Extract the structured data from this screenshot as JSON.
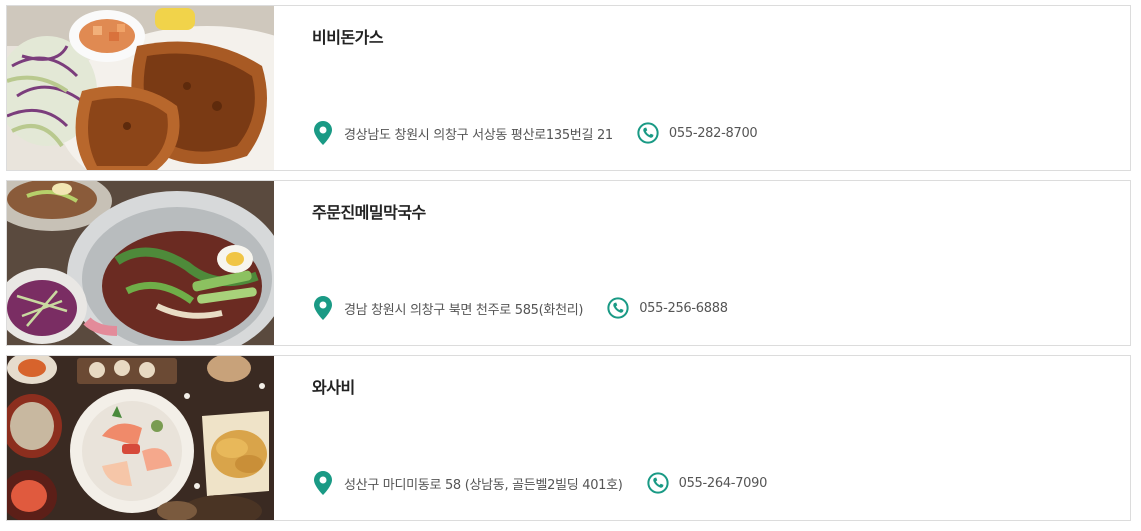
{
  "accent_color": "#1a9a85",
  "restaurants": [
    {
      "name": "비비돈가스",
      "address": "경상남도 창원시 의창구 서상동 평산로135번길 21",
      "phone": "055-282-8700",
      "address_icon": "map-pin-icon",
      "phone_icon": "phone-icon"
    },
    {
      "name": "주문진메밀막국수",
      "address": "경남 창원시 의창구 북면 천주로 585(화천리)",
      "phone": "055-256-6888",
      "address_icon": "map-pin-icon",
      "phone_icon": "phone-icon"
    },
    {
      "name": "와사비",
      "address": "성산구 마디미동로 58 (상남동, 골든벨2빌딩 401호)",
      "phone": "055-264-7090",
      "address_icon": "map-pin-icon",
      "phone_icon": "phone-icon"
    }
  ]
}
